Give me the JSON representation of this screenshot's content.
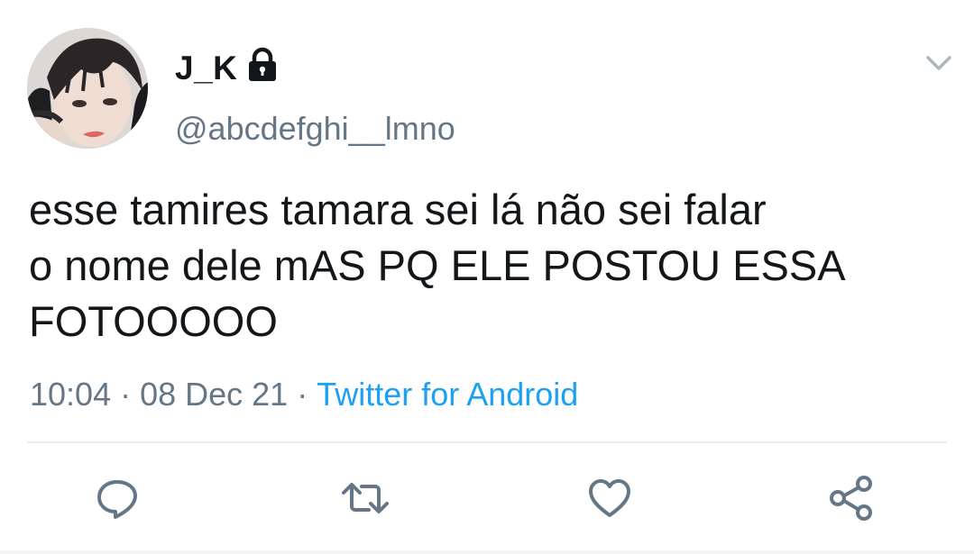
{
  "tweet": {
    "author": {
      "display_name": "J_K",
      "handle": "@abcdefghi__lmno",
      "protected": true
    },
    "text": "esse tamires tamara sei lá não sei falar\no nome dele mAS PQ ELE POSTOU ESSA\nFOTOOOOO",
    "time": "10:04",
    "date": "08 Dec 21",
    "separator": "·",
    "source": "Twitter for Android"
  },
  "icons": {
    "lock": "lock-icon",
    "caret": "chevron-down-icon",
    "reply": "reply-icon",
    "retweet": "retweet-icon",
    "like": "heart-icon",
    "share": "share-icon"
  },
  "colors": {
    "text": "#14171a",
    "secondary": "#657786",
    "link": "#1da1f2",
    "divider": "#e6ecf0",
    "icon": "#657786"
  }
}
